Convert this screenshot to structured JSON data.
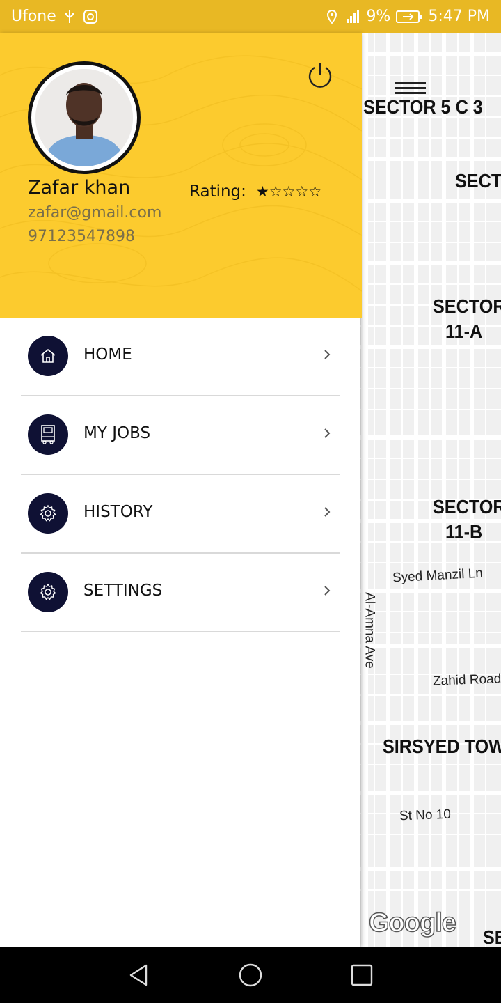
{
  "status_bar": {
    "carrier": "Ufone",
    "battery": "9%",
    "time": "5:47 PM"
  },
  "profile": {
    "name": "Zafar khan",
    "email": "zafar@gmail.com",
    "phone": "97123547898",
    "rating_label": "Rating:",
    "rating_value": 1,
    "rating_max": 5,
    "stars": "★☆☆☆☆"
  },
  "menu": {
    "items": [
      {
        "label": "HOME",
        "icon": "home-icon"
      },
      {
        "label": "MY JOBS",
        "icon": "truck-icon"
      },
      {
        "label": "HISTORY",
        "icon": "gear-icon"
      },
      {
        "label": "SETTINGS",
        "icon": "gear-icon"
      }
    ]
  },
  "map": {
    "labels": {
      "sector_5c3": "SECTOR 5 C 3",
      "secto": "SECTO",
      "sector_11a_1": "SECTOR",
      "sector_11a_2": "11-A",
      "sector_11b_1": "SECTOR",
      "sector_11b_2": "11-B",
      "syed_manzil": "Syed Manzil Ln",
      "al_amna": "Al-Amna Ave",
      "zahid_road": "Zahid Road",
      "sirsyed": "SIRSYED TOW",
      "st_no_10": "St No 10",
      "se": "SE"
    },
    "google": "Google"
  },
  "colors": {
    "header_yellow": "#fccb2e",
    "status_yellow": "#e8b824",
    "menu_icon_bg": "#0f1134"
  }
}
